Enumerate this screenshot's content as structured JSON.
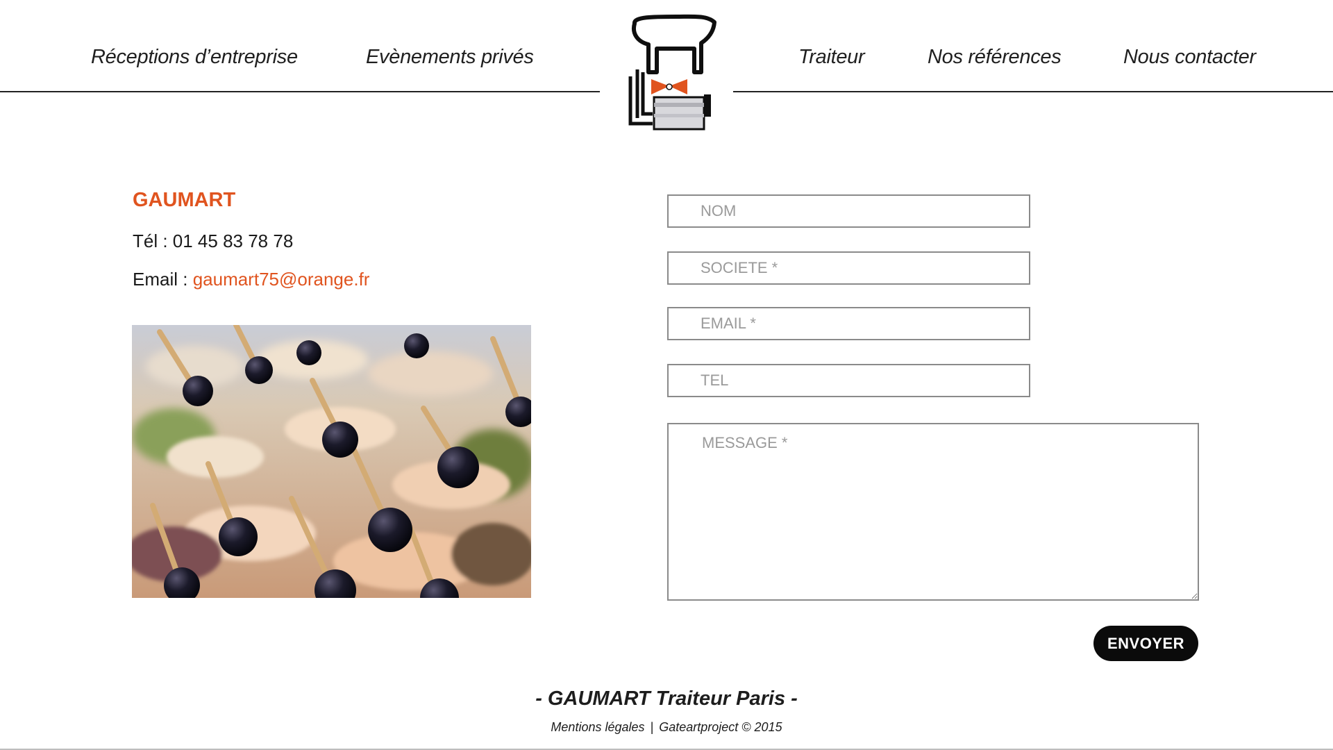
{
  "nav": {
    "items": [
      {
        "label": "Réceptions d’entreprise"
      },
      {
        "label": "Evènements privés"
      },
      {
        "label": "Traiteur"
      },
      {
        "label": "Nos références"
      },
      {
        "label": "Nous contacter"
      }
    ]
  },
  "logo": {
    "icon": "chef-hat-bowtie-logo"
  },
  "contact": {
    "name": "GAUMART",
    "tel_label": "Tél : 01 45 83 78 78",
    "email_label": "Email : ",
    "email": "gaumart75@orange.fr"
  },
  "photo": {
    "icon": "canape-food-photo"
  },
  "form": {
    "nom_placeholder": "NOM",
    "societe_placeholder": "SOCIETE *",
    "email_placeholder": "EMAIL *",
    "tel_placeholder": "TEL",
    "message_placeholder": "MESSAGE *",
    "submit_label": "ENVOYER"
  },
  "footer": {
    "title": "- GAUMART Traiteur Paris -",
    "legal": "Mentions légales",
    "separator": "|",
    "credit": "Gateartproject © 2015"
  },
  "colors": {
    "accent": "#e0541f",
    "text": "#1a1a1a",
    "button": "#0b0b0b",
    "border": "#8a8a8a"
  }
}
